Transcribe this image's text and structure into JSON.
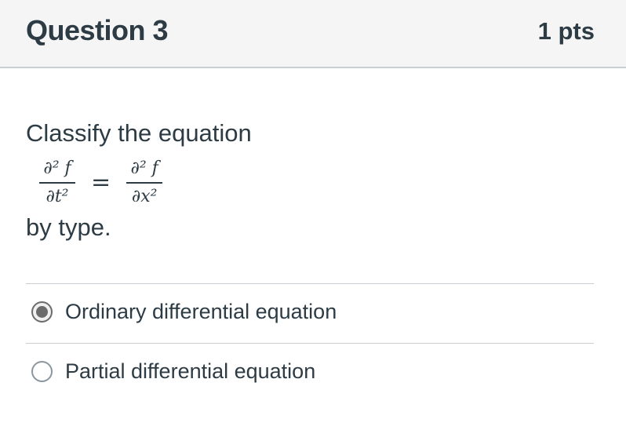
{
  "question": {
    "title": "Question 3",
    "points": "1 pts",
    "prompt_before": "Classify the equation",
    "prompt_after": "by type.",
    "equation": {
      "lhs_numerator": "∂² f",
      "lhs_denominator": "∂t²",
      "operator": "=",
      "rhs_numerator": "∂² f",
      "rhs_denominator": "∂x²"
    },
    "answers": [
      {
        "label": "Ordinary differential equation",
        "selected": true
      },
      {
        "label": "Partial differential equation",
        "selected": false
      }
    ]
  },
  "colors": {
    "text": "#2d3b45",
    "header_bg": "#f5f5f5",
    "divider": "#c7cdd1",
    "radio_selected": "#6b6b6b"
  }
}
